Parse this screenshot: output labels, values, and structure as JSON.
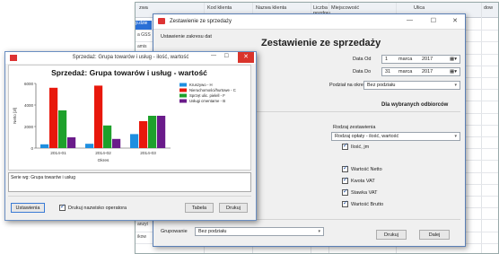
{
  "table_window": {
    "headers": [
      "zwa",
      "Kod klienta",
      "Nazwa klienta",
      "Liczba pozdow",
      "Miejscowość",
      "Ulica",
      "dow"
    ],
    "cells": [
      "p.dzie",
      "a GSS",
      "amis",
      "p nr 2",
      "",
      "",
      "",
      "",
      "",
      "",
      "",
      "",
      "",
      "",
      "",
      "",
      "enty",
      "anzyt",
      "ikow"
    ]
  },
  "main_dialog": {
    "title": "Zestawienie ze sprzedaży",
    "heading": "Zestawienie ze sprzedaży",
    "window_buttons": [
      "—",
      "☐",
      "✕"
    ],
    "date_section_label": "Ustawienie zakresu dat",
    "date_from": {
      "label": "Data Od",
      "day": "1",
      "month": "marca",
      "year": "2017"
    },
    "date_to": {
      "label": "Data Do",
      "day": "31",
      "month": "marca",
      "year": "2017"
    },
    "period_label": "Podział na okresy",
    "period_value": "Bez podziału",
    "recipients_label": "Dla wybranych odbiorców",
    "report_type_label": "Rodzaj zestawienia",
    "report_type_value": "Rodzaj opłaty - ilość, wartość",
    "checkboxes": [
      "Ilość, jm",
      "Wartość Netto",
      "Kwota VAT",
      "Stawka VAT",
      "Wartość Brutto"
    ],
    "grouping_label": "Grupowanie",
    "grouping_value": "Bez podziału",
    "print_button": "Drukuj",
    "next_button": "Dalej"
  },
  "chart_window": {
    "title": "Sprzedaż: Grupa towarów i usług - ilość, wartość",
    "window_buttons": [
      "—",
      "☐",
      "✕"
    ],
    "series_info": "Serie wg: Grupa towarów i usług",
    "settings_button": "Ustawienia",
    "print_operator_label": "Drukuj nazwisko operatora",
    "table_button": "Tabela",
    "print_button": "Drukuj"
  },
  "chart_data": {
    "type": "bar",
    "title": "Sprzedaż: Grupa towarów i usług - wartość",
    "xlabel": "Okres",
    "ylabel": "Netto [zł]",
    "categories": [
      "2014-01",
      "2014-02",
      "2014-03"
    ],
    "ylim": [
      0,
      6000
    ],
    "yticks": [
      "0",
      "2000",
      "4000",
      "6000"
    ],
    "series": [
      {
        "name": "Kruszywo - H",
        "color": "#1f8fe0",
        "values": [
          350,
          400,
          1300
        ]
      },
      {
        "name": "Nieruchomości/hurtowe - C",
        "color": "#e8180c",
        "values": [
          5600,
          5800,
          2500
        ]
      },
      {
        "name": "Sprzęt ulic. pielell - F",
        "color": "#1ea12b",
        "values": [
          3500,
          2100,
          3000
        ]
      },
      {
        "name": "Usługi cmentarne - B",
        "color": "#6a1b8a",
        "values": [
          1000,
          850,
          3000
        ]
      }
    ],
    "legend": "right"
  }
}
